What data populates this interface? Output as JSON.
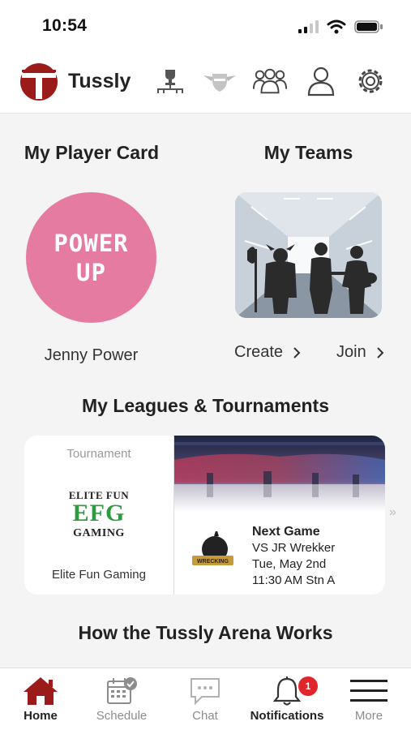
{
  "status_bar": {
    "time": "10:54"
  },
  "header": {
    "app_name": "Tussly"
  },
  "player_card": {
    "title": "My Player Card",
    "avatar_line1": "POWER",
    "avatar_line2": "UP",
    "player_name": "Jenny Power"
  },
  "teams": {
    "title": "My Teams",
    "create_label": "Create",
    "join_label": "Join"
  },
  "leagues": {
    "title": "My Leagues & Tournaments",
    "card": {
      "type": "Tournament",
      "logo_top": "ELITE FUN",
      "logo_mid": "EFG",
      "logo_bottom": "GAMING",
      "name": "Elite Fun Gaming",
      "team_logo_text": "WRECKING",
      "next_game_title": "Next Game",
      "opponent": "VS JR Wrekker",
      "date": "Tue, May 2nd",
      "time_station": "11:30 AM Stn A"
    },
    "more_indicator": "»"
  },
  "arena": {
    "title": "How the Tussly Arena Works"
  },
  "tabs": [
    {
      "label": "Home"
    },
    {
      "label": "Schedule"
    },
    {
      "label": "Chat"
    },
    {
      "label": "Notifications",
      "badge": "1"
    },
    {
      "label": "More"
    }
  ],
  "colors": {
    "brand": "#9b1b1b",
    "avatar": "#e57ba0",
    "efg_green": "#2e9a3f",
    "badge": "#e0252b"
  }
}
